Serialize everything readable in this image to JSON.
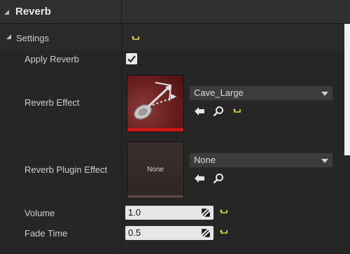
{
  "category": {
    "title": "Reverb"
  },
  "settings": {
    "label": "Settings"
  },
  "apply_reverb": {
    "label": "Apply Reverb",
    "checked": true
  },
  "reverb_effect": {
    "label": "Reverb Effect",
    "value": "Cave_Large"
  },
  "reverb_plugin_effect": {
    "label": "Reverb Plugin Effect",
    "value": "None",
    "thumbnail_text": "None"
  },
  "volume": {
    "label": "Volume",
    "value": "1.0"
  },
  "fade_time": {
    "label": "Fade Time",
    "value": "0.5"
  },
  "colors": {
    "reset_arrow": "#e8d84a",
    "thumb_bar": "#c81818"
  }
}
